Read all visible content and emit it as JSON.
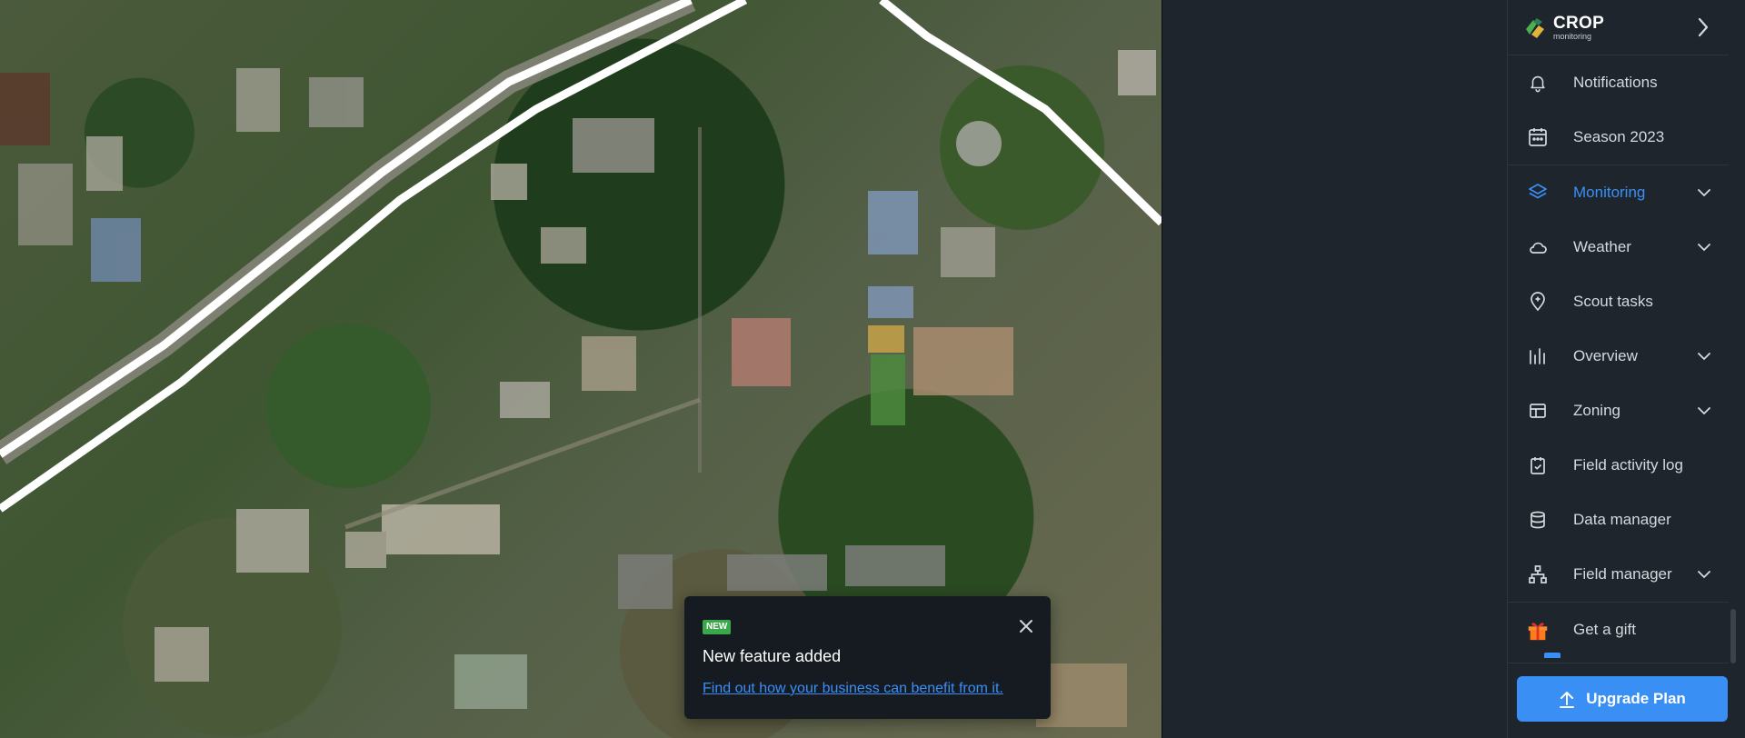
{
  "brand": {
    "title": "CROP",
    "subtitle": "monitoring",
    "logo_icon": "crop-monitoring-logo"
  },
  "sidebar": {
    "items": [
      {
        "label": "Notifications",
        "icon": "bell-icon",
        "expandable": false,
        "active": false
      },
      {
        "label": "Season 2023",
        "icon": "calendar-icon",
        "expandable": false,
        "active": false
      },
      {
        "label": "Monitoring",
        "icon": "layers-icon",
        "expandable": true,
        "active": true
      },
      {
        "label": "Weather",
        "icon": "cloud-icon",
        "expandable": true,
        "active": false
      },
      {
        "label": "Scout tasks",
        "icon": "map-pin-plus-icon",
        "expandable": false,
        "active": false
      },
      {
        "label": "Overview",
        "icon": "bar-chart-icon",
        "expandable": true,
        "active": false
      },
      {
        "label": "Zoning",
        "icon": "layout-icon",
        "expandable": true,
        "active": false
      },
      {
        "label": "Field activity log",
        "icon": "clipboard-check-icon",
        "expandable": false,
        "active": false
      },
      {
        "label": "Data manager",
        "icon": "database-icon",
        "expandable": false,
        "active": false
      },
      {
        "label": "Field manager",
        "icon": "hierarchy-icon",
        "expandable": true,
        "active": false
      },
      {
        "label": "Get a gift",
        "icon": "gift-icon",
        "expandable": false,
        "active": false
      }
    ]
  },
  "upgrade": {
    "label": "Upgrade Plan"
  },
  "toast": {
    "badge": "NEW",
    "title": "New feature added",
    "link": "Find out how your business can benefit from it."
  },
  "colors": {
    "accent": "#3a8ff5",
    "sidebar_bg": "#1f252c",
    "badge_green": "#3aa84a"
  }
}
